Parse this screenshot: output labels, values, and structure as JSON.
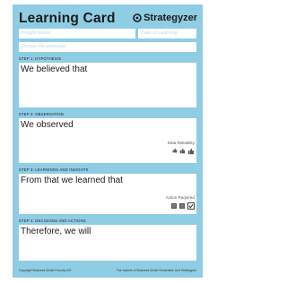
{
  "header": {
    "title": "Learning Card",
    "brand": "Strategyzer"
  },
  "fields": {
    "insight_name_placeholder": "Insight Name",
    "date_placeholder": "Date of Learning",
    "person_placeholder": "Person Responsible"
  },
  "steps": [
    {
      "label": "STEP 1: HYPOTHESIS",
      "heading": "We believed that"
    },
    {
      "label": "STEP 2: OBSERVATION",
      "heading": "We observed",
      "aside_label": "Data Reliability:"
    },
    {
      "label": "STEP 3: LEARNINGS AND INSIGHTS",
      "heading": "From that we learned that",
      "aside_label": "Action Required:"
    },
    {
      "label": "STEP 4: DECISIONS AND ACTIONS",
      "heading": "Therefore, we will"
    }
  ],
  "footer": {
    "left": "Copyright Business Model Foundry AG",
    "right": "The makers of Business Model Generation and Strategyzer"
  },
  "colors": {
    "card_background": "#8fcde5",
    "text": "#1b1b1b"
  },
  "icons": {
    "brand": "strategyzer-logo-icon",
    "reliability": "thumbs-up-icon",
    "action": "checkbox-icon"
  }
}
